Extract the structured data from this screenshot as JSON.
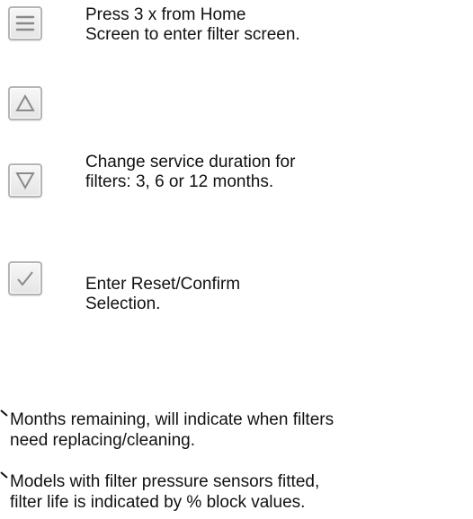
{
  "buttons": [
    {
      "icon": "menu-icon",
      "desc": "Press 3 x from Home\nScreen to enter filter screen."
    },
    {
      "icon": "up-triangle-icon",
      "desc": ""
    },
    {
      "icon": "down-triangle-icon",
      "desc": "Change service duration for\nfilters: 3, 6 or 12 months."
    },
    {
      "icon": "checkmark-icon",
      "desc": "Enter Reset/Confirm\nSelection."
    }
  ],
  "notes": [
    "Months remaining, will indicate when filters\nneed replacing/cleaning.",
    "Models with filter pressure sensors fitted,\nfilter life is indicated by % block values."
  ],
  "colors": {
    "icon_stroke": "#8a8a8a",
    "key_border": "#b5b5b5",
    "text": "#111111"
  }
}
